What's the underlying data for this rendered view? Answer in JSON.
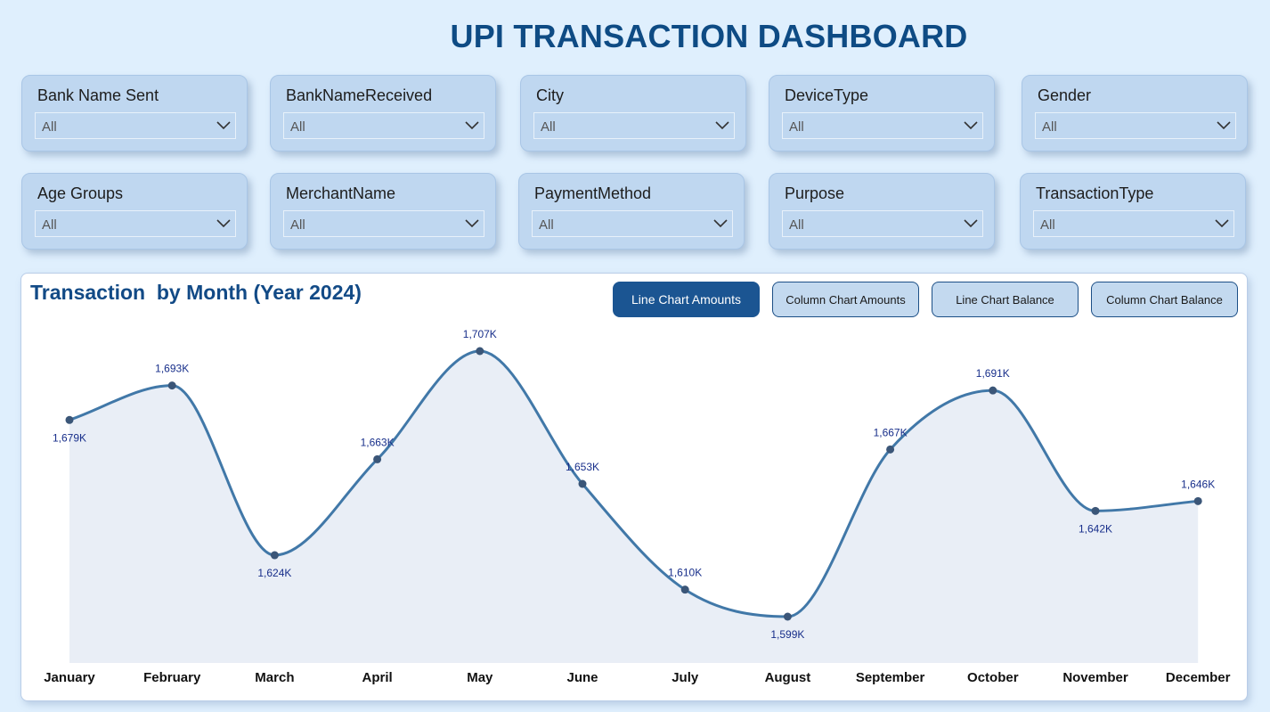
{
  "header": {
    "title": "UPI TRANSACTION DASHBOARD"
  },
  "filters": [
    {
      "label": "Bank Name Sent",
      "value": "All"
    },
    {
      "label": "BankNameReceived",
      "value": "All"
    },
    {
      "label": "City",
      "value": "All"
    },
    {
      "label": "DeviceType",
      "value": "All"
    },
    {
      "label": "Gender",
      "value": "All"
    },
    {
      "label": "Age Groups",
      "value": "All"
    },
    {
      "label": "MerchantName",
      "value": "All"
    },
    {
      "label": "PaymentMethod",
      "value": "All"
    },
    {
      "label": "Purpose",
      "value": "All"
    },
    {
      "label": "TransactionType",
      "value": "All"
    }
  ],
  "toggle_buttons": [
    {
      "label": "Line Chart Amounts",
      "active": true
    },
    {
      "label": "Column Chart Amounts",
      "active": false
    },
    {
      "label": "Line Chart Balance",
      "active": false
    },
    {
      "label": "Column Chart Balance",
      "active": false
    }
  ],
  "colors": {
    "line": "#4178a8",
    "area": "#e9eef6",
    "marker": "#3b5678",
    "data_label": "#172e8a",
    "title": "#124a86"
  },
  "chart_data": {
    "type": "area",
    "title": "Transaction  by Month (Year 2024)",
    "categories": [
      "January",
      "February",
      "March",
      "April",
      "May",
      "June",
      "July",
      "August",
      "September",
      "October",
      "November",
      "December"
    ],
    "values": [
      1679,
      1693,
      1624,
      1663,
      1707,
      1653,
      1610,
      1599,
      1667,
      1691,
      1642,
      1646
    ],
    "data_labels": [
      "1,679K",
      "1,693K",
      "1,624K",
      "1,663K",
      "1,707K",
      "1,653K",
      "1,610K",
      "1,599K",
      "1,667K",
      "1,691K",
      "1,642K",
      "1,646K"
    ],
    "label_position": [
      "below",
      "above",
      "below",
      "above",
      "above",
      "above",
      "above",
      "below",
      "above",
      "above",
      "below",
      "above"
    ],
    "unit": "K",
    "smooth": true,
    "grid": false,
    "legend": "none"
  }
}
